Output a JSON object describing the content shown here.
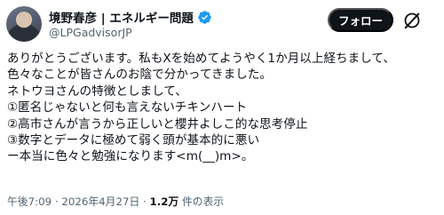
{
  "author": {
    "display_name": "境野春彦 | エネルギー問題",
    "handle": "@LPGadvisorJP",
    "verified": true
  },
  "follow_label": "フォロー",
  "grok_icon": "grok-icon",
  "tweet": {
    "lines": [
      "ありがとうございます。私もXを始めてようやく1か月以上経ちまして、",
      "色々なことが皆さんのお陰で分かってきました。",
      "ネトウヨさんの特徴としまして、",
      "①匿名じゃないと何も言えないチキンハート",
      "②高市さんが言うから正しいと櫻井よしこ的な思考停止",
      "③数字とデータに極めて弱く頭が基本的に悪い",
      "ー本当に色々と勉強になります<m(__)m>。"
    ]
  },
  "meta": {
    "time": "午後7:09",
    "separator1": " · ",
    "date": "2026年4月27日",
    "separator2": " · ",
    "views_count": "1.2万",
    "views_label": " 件の表示"
  },
  "colors": {
    "text": "#0f1419",
    "secondary": "#536471",
    "verified": "#1d9bf0",
    "button_bg": "#0f1419"
  }
}
